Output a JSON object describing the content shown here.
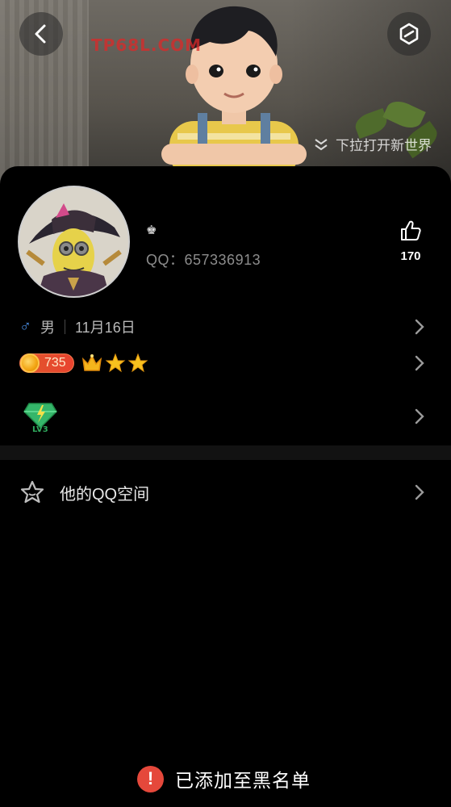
{
  "header": {
    "watermark": "TP68L.COM",
    "pull_hint": "下拉打开新世界"
  },
  "profile": {
    "qq_text": "QQ：657336913",
    "likes": "170",
    "gender": "男",
    "birthday": "11月16日",
    "coin_value": "735"
  },
  "menu": {
    "qzone_label": "他的QQ空间"
  },
  "toast": {
    "text": "已添加至黑名单"
  },
  "colors": {
    "background": "#000000",
    "gender_blue": "#4a8fe6",
    "toast_red": "#e5483b",
    "coin_badge": "#e9432f",
    "gold": "#f2a412"
  },
  "icons": [
    "back-arrow-icon",
    "share-box-icon",
    "double-chevron-down-icon",
    "crown-small-icon",
    "thumbs-up-icon",
    "male-icon",
    "chevron-right-icon",
    "coin-icon",
    "crown-icon",
    "star-icon",
    "vip-diamond-icon",
    "star-outline-icon",
    "exclamation-icon"
  ]
}
